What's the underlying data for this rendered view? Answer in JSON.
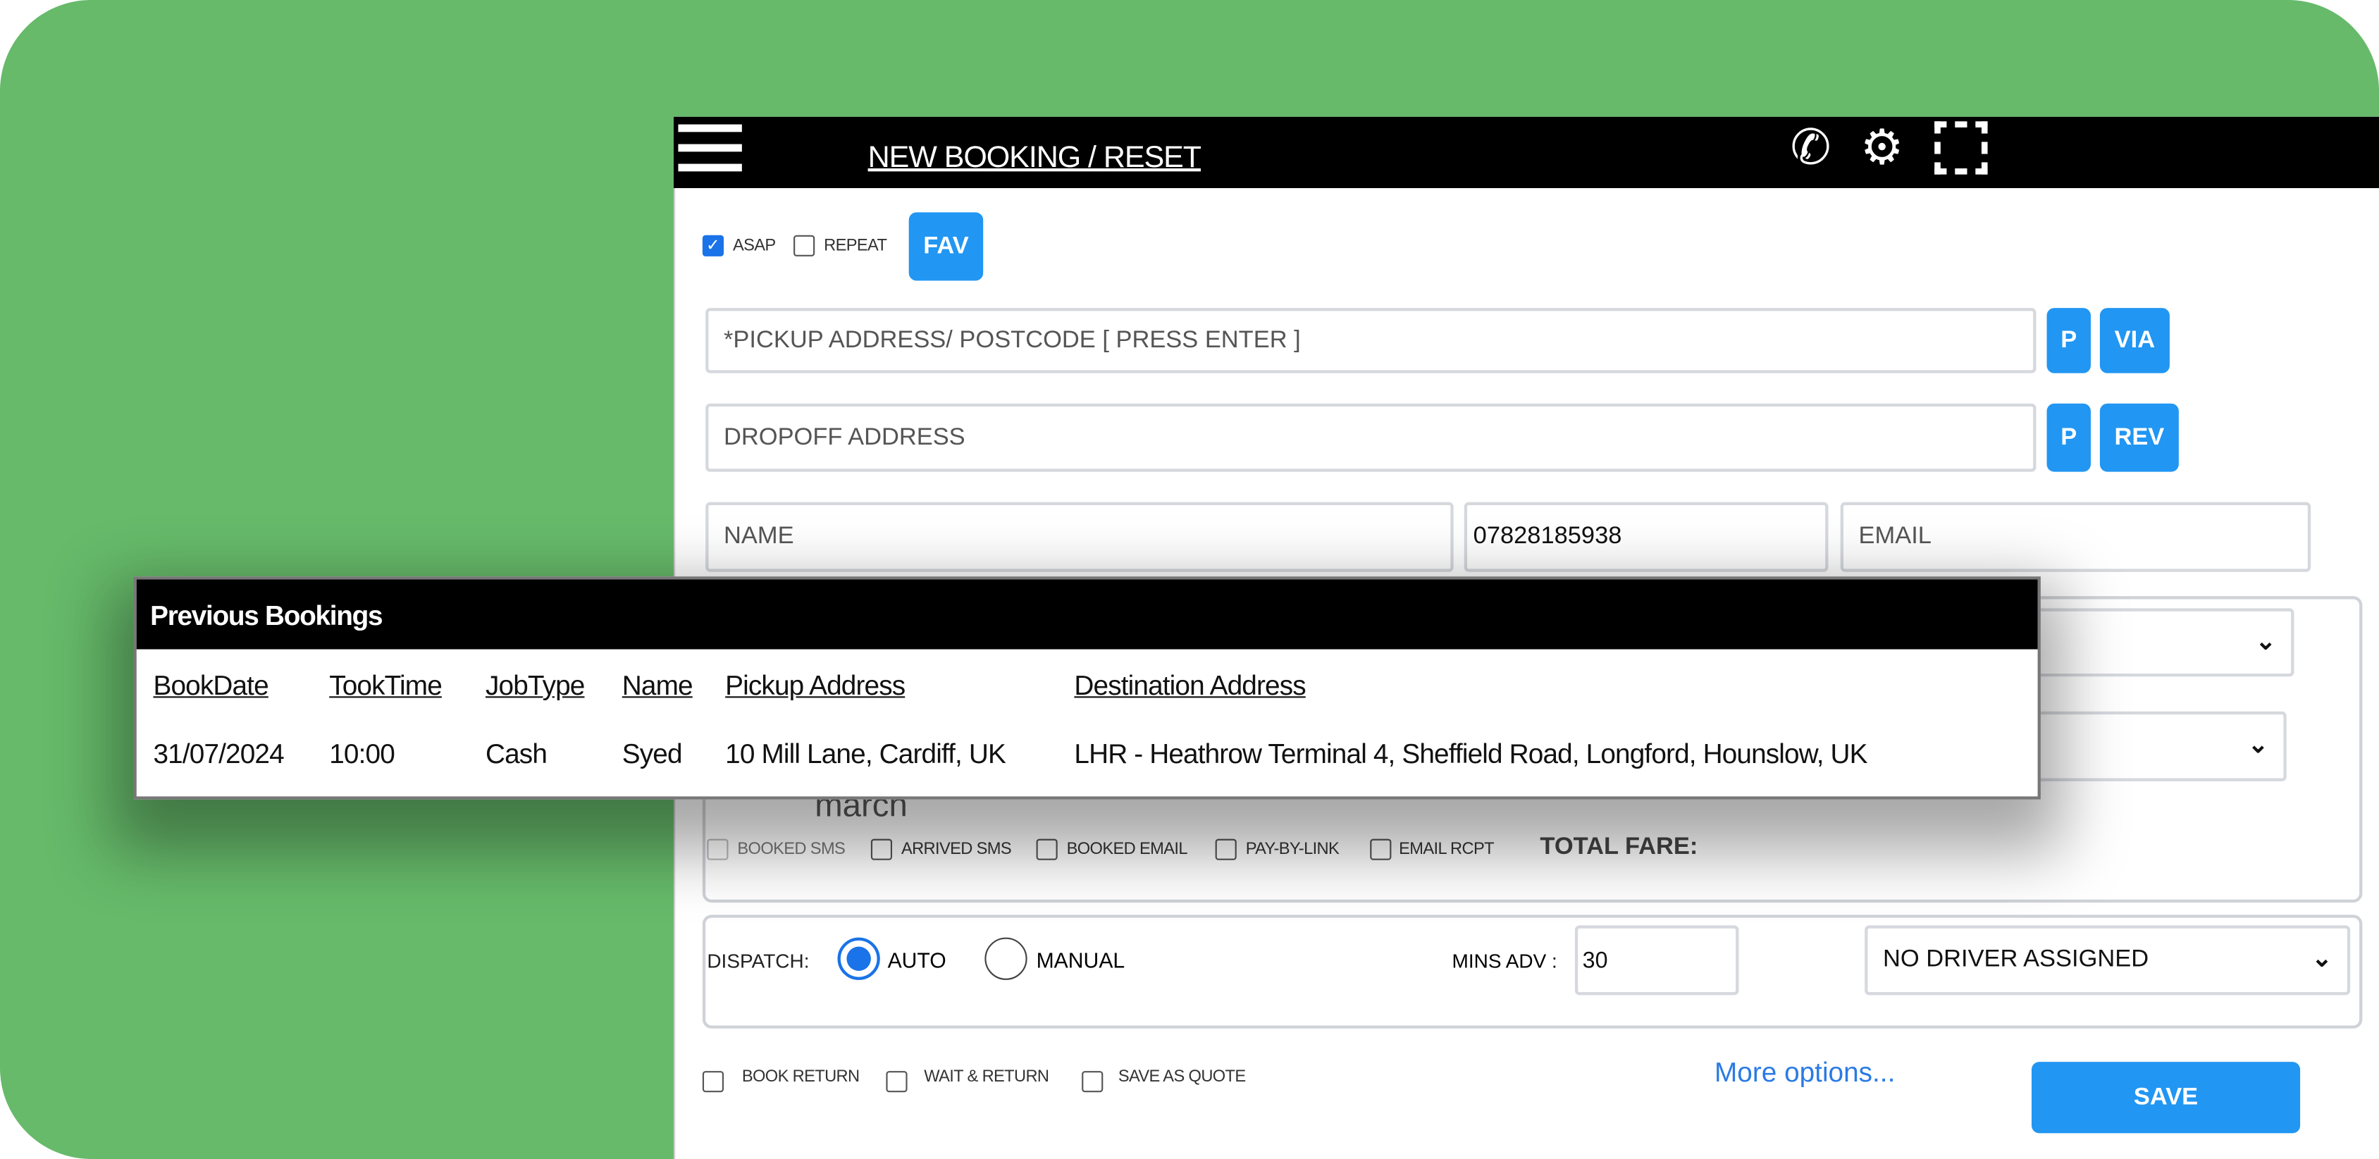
{
  "header": {
    "title": "NEW BOOKING / RESET",
    "icons": [
      "menu-icon",
      "phone-icon",
      "gear-icon",
      "fullscreen-icon"
    ]
  },
  "options": {
    "asap": "ASAP",
    "asap_checked": true,
    "repeat": "REPEAT",
    "fav": "FAV"
  },
  "pickup": {
    "placeholder": "*PICKUP ADDRESS/ POSTCODE [ PRESS ENTER ]",
    "p": "P",
    "via": "VIA"
  },
  "dropoff": {
    "placeholder": "DROPOFF ADDRESS",
    "p": "P",
    "rev": "REV"
  },
  "contact": {
    "name_placeholder": "NAME",
    "phone": "07828185938",
    "email_placeholder": "EMAIL"
  },
  "details": {
    "select1": "1",
    "partial_text": "march",
    "checks": [
      "BOOKED SMS",
      "ARRIVED SMS",
      "BOOKED EMAIL",
      "PAY-BY-LINK",
      "EMAIL RCPT"
    ],
    "total_fare": "TOTAL FARE:"
  },
  "dispatch": {
    "label": "DISPATCH:",
    "auto": "AUTO",
    "manual": "MANUAL",
    "selected": "AUTO",
    "mins_label": "MINS ADV :",
    "mins_value": "30",
    "driver": "NO DRIVER ASSIGNED"
  },
  "footer": {
    "book_return": "BOOK RETURN",
    "wait_return": "WAIT & RETURN",
    "save_quote": "SAVE AS QUOTE",
    "more": "More options...",
    "save": "SAVE"
  },
  "popup": {
    "title": "Previous Bookings",
    "columns": [
      "BookDate",
      "TookTime",
      "JobType",
      "Name",
      "Pickup Address",
      "Destination Address"
    ],
    "rows": [
      [
        "31/07/2024",
        "10:00",
        "Cash",
        "Syed",
        "10 Mill Lane, Cardiff, UK",
        "LHR - Heathrow Terminal 4, Sheffield Road, Longford, Hounslow, UK"
      ]
    ]
  },
  "colors": {
    "background": "#66BA6A",
    "accent": "#2196F3",
    "header": "#000000"
  }
}
